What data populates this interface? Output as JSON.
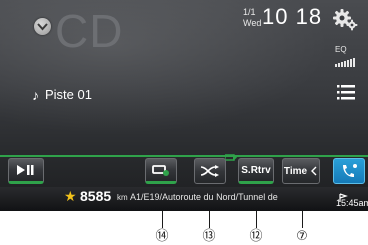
{
  "source": {
    "title": "CD"
  },
  "status": {
    "date": "1/1",
    "day": "Wed",
    "time": "10 18"
  },
  "menu": {
    "eq_label": "EQ"
  },
  "track": {
    "title": "Piste 01"
  },
  "buttons": {
    "srtrv_label": "S.Rtrv",
    "time_label": "Time"
  },
  "navigation": {
    "distance": "8585",
    "distance_unit": "km",
    "road": "A1/E19/Autoroute du Nord/Tunnel de",
    "eta": "15:45am"
  },
  "callouts": [
    "⑭",
    "⑬",
    "⑫",
    "⑦"
  ],
  "colors": {
    "accent_green": "#2fa24a",
    "phone_blue": "#1b8cc8",
    "star": "#f2c21b"
  },
  "icons": [
    "chevron-down-icon",
    "settings-icon",
    "eq-icon",
    "list-icon",
    "music-note-icon",
    "play-pause-icon",
    "repeat-icon",
    "shuffle-icon",
    "phone-icon",
    "star-icon",
    "eta-flag-icon"
  ]
}
